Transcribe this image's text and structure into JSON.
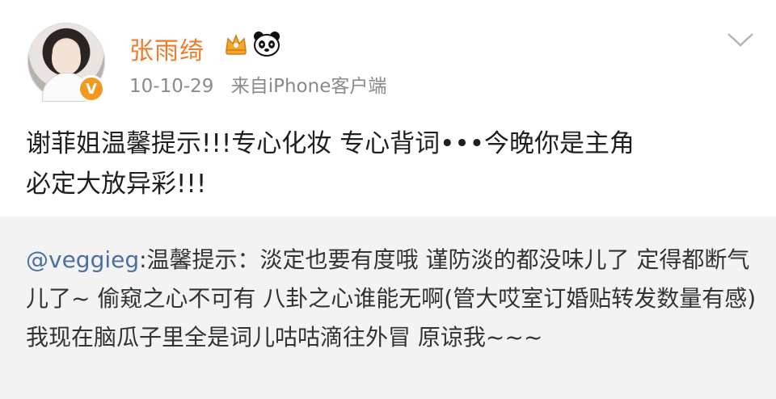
{
  "header": {
    "username": "张雨绮",
    "time": "10-10-29",
    "source": "来自iPhone客户端",
    "icons": [
      "avatar",
      "verified-badge",
      "crown-icon",
      "panda-icon",
      "chevron-down-icon"
    ]
  },
  "post": {
    "text_line1": "谢菲姐温馨提示!!!专心化妆 专心背词•••今晚你是主角",
    "text_line2": "必定大放异彩!!!"
  },
  "repost": {
    "mention": "@veggieg",
    "text": ":温馨提示：淡定也要有度哦 谨防淡的都没味儿了 定得都断气儿了~ 偷窥之心不可有 八卦之心谁能无啊(管大哎室订婚贴转发数量有感) 我现在脑瓜子里全是词儿咕咕滴往外冒 原谅我~~~"
  },
  "colors": {
    "username": "#f07b29",
    "meta": "#8a8a8a",
    "mention": "#4b6fa3",
    "repost_bg": "#f3f3f3",
    "badge": "#f29a1f"
  }
}
